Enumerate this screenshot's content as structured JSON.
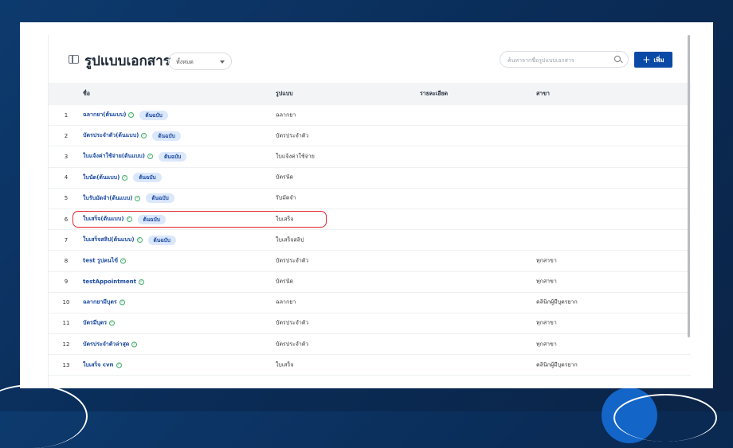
{
  "header": {
    "title": "รูปแบบเอกสาร",
    "filter_value": "ทั้งหมด",
    "search_placeholder": "ค้นหาจากชื่อรูปแบบเอกสาร",
    "add_label": "เพิ่ม"
  },
  "table": {
    "columns": {
      "name": "ชื่อ",
      "format": "รูปแบบ",
      "detail": "รายละเอียด",
      "branch": "สาขา"
    },
    "rows": [
      {
        "num": "1",
        "name": "ฉลากยา(ต้นแบบ)",
        "badge": "ต้นฉบับ",
        "format": "ฉลากยา",
        "detail": "",
        "branch": ""
      },
      {
        "num": "2",
        "name": "บัตรประจำตัว(ต้นแบบ)",
        "badge": "ต้นฉบับ",
        "format": "บัตรประจำตัว",
        "detail": "",
        "branch": ""
      },
      {
        "num": "3",
        "name": "ใบแจ้งค่าใช้จ่าย(ต้นแบบ)",
        "badge": "ต้นฉบับ",
        "format": "ใบแจ้งค่าใช้จ่าย",
        "detail": "",
        "branch": ""
      },
      {
        "num": "4",
        "name": "ใบนัด(ต้นแบบ)",
        "badge": "ต้นฉบับ",
        "format": "บัตรนัด",
        "detail": "",
        "branch": ""
      },
      {
        "num": "5",
        "name": "ใบรับมัดจำ(ต้นแบบ)",
        "badge": "ต้นฉบับ",
        "format": "รับมัดจำ",
        "detail": "",
        "branch": ""
      },
      {
        "num": "6",
        "name": "ใบเสร็จ(ต้นแบบ)",
        "badge": "ต้นฉบับ",
        "format": "ใบเสร็จ",
        "detail": "",
        "branch": ""
      },
      {
        "num": "7",
        "name": "ใบเสร็จสลิป(ต้นแบบ)",
        "badge": "ต้นฉบับ",
        "format": "ใบเสร็จสลิป",
        "detail": "",
        "branch": ""
      },
      {
        "num": "8",
        "name": "test รูปคนไข้",
        "badge": "",
        "format": "บัตรประจำตัว",
        "detail": "",
        "branch": "ทุกสาขา"
      },
      {
        "num": "9",
        "name": "testAppointment",
        "badge": "",
        "format": "บัตรนัด",
        "detail": "",
        "branch": "ทุกสาขา"
      },
      {
        "num": "10",
        "name": "ฉลากยามีบุตร",
        "badge": "",
        "format": "ฉลากยา",
        "detail": "",
        "branch": "คลินิกผู้มีบุตรยาก"
      },
      {
        "num": "11",
        "name": "บัตรมีบุตร",
        "badge": "",
        "format": "บัตรประจำตัว",
        "detail": "",
        "branch": "ทุกสาขา"
      },
      {
        "num": "12",
        "name": "บัตรประจำตัวล่าสุด",
        "badge": "",
        "format": "บัตรประจำตัว",
        "detail": "",
        "branch": "ทุกสาขา"
      },
      {
        "num": "13",
        "name": "ใบเสร็จ cvn",
        "badge": "",
        "format": "ใบเสร็จ",
        "detail": "",
        "branch": "คลินิกผู้มีบุตรยาก"
      }
    ]
  },
  "colors": {
    "accent": "#0a4aa6",
    "highlight": "#e0242c",
    "link": "#1b4aa0"
  }
}
